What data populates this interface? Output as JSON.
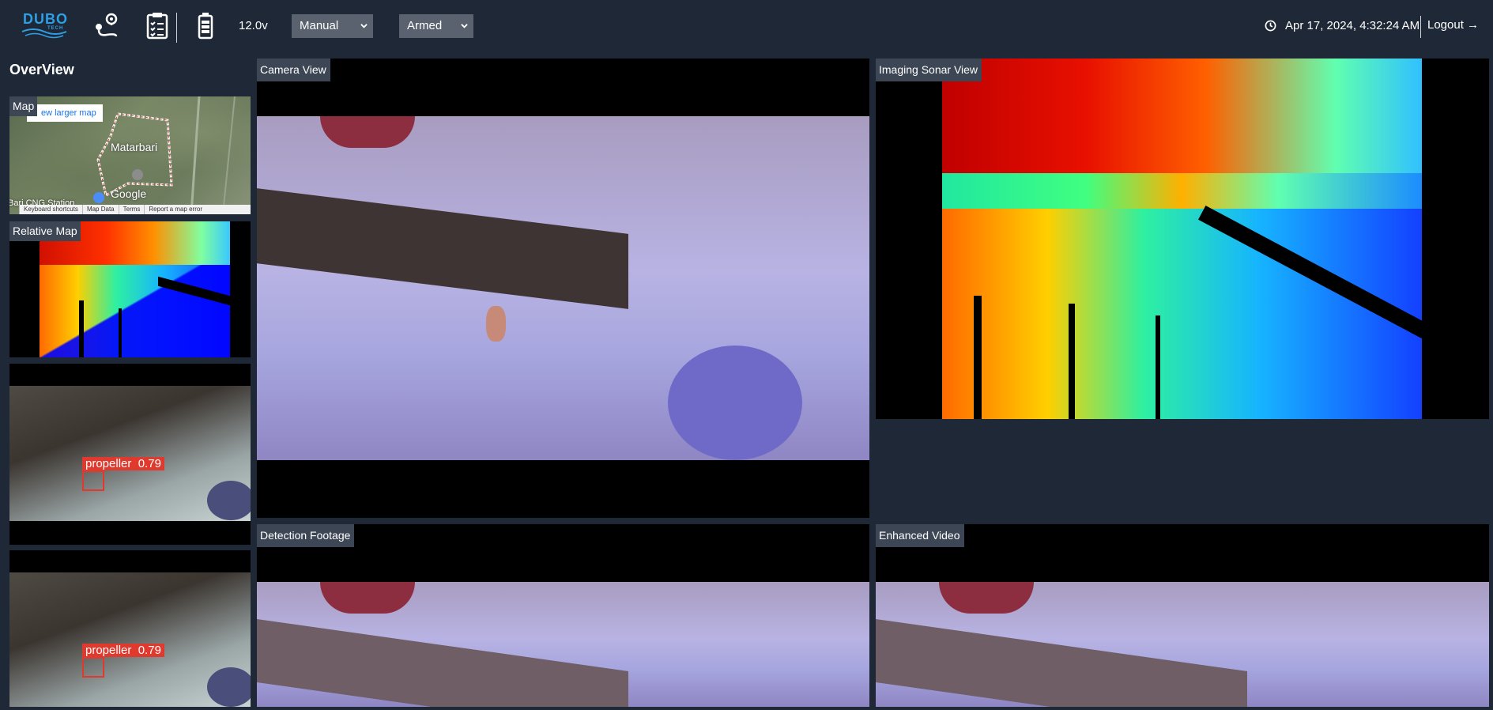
{
  "header": {
    "logo_main": "DUBO",
    "logo_sub": "TECH",
    "voltage": "12.0v",
    "mode_select": "Manual",
    "arm_select": "Armed",
    "datetime": "Apr 17, 2024, 4:32:24 AM",
    "logout": "Logout →",
    "icons": [
      "route-icon",
      "checklist-icon",
      "battery-icon",
      "clock-icon"
    ]
  },
  "sidebar": {
    "title": "OverView",
    "map": {
      "label": "Map",
      "link": "ew larger map",
      "city": "Matarbari",
      "station": "Bari CNG Station",
      "google": "Google",
      "footer": [
        "Keyboard shortcuts",
        "Map Data",
        "Terms",
        "Report a map error"
      ]
    },
    "relative_map_label": "Relative Map",
    "detections": [
      {
        "label": "propeller",
        "score": "0.79"
      },
      {
        "label": "propeller",
        "score": "0.79"
      }
    ]
  },
  "main": {
    "camera_label": "Camera View",
    "sonar_label": "Imaging Sonar View",
    "detection_label": "Detection Footage",
    "enhanced_label": "Enhanced Video"
  },
  "colors": {
    "background": "#1f2836",
    "label_bg": "#3d4654",
    "select_bg": "#59626e",
    "accent": "#2e9fe6",
    "detection": "#e0392e"
  }
}
